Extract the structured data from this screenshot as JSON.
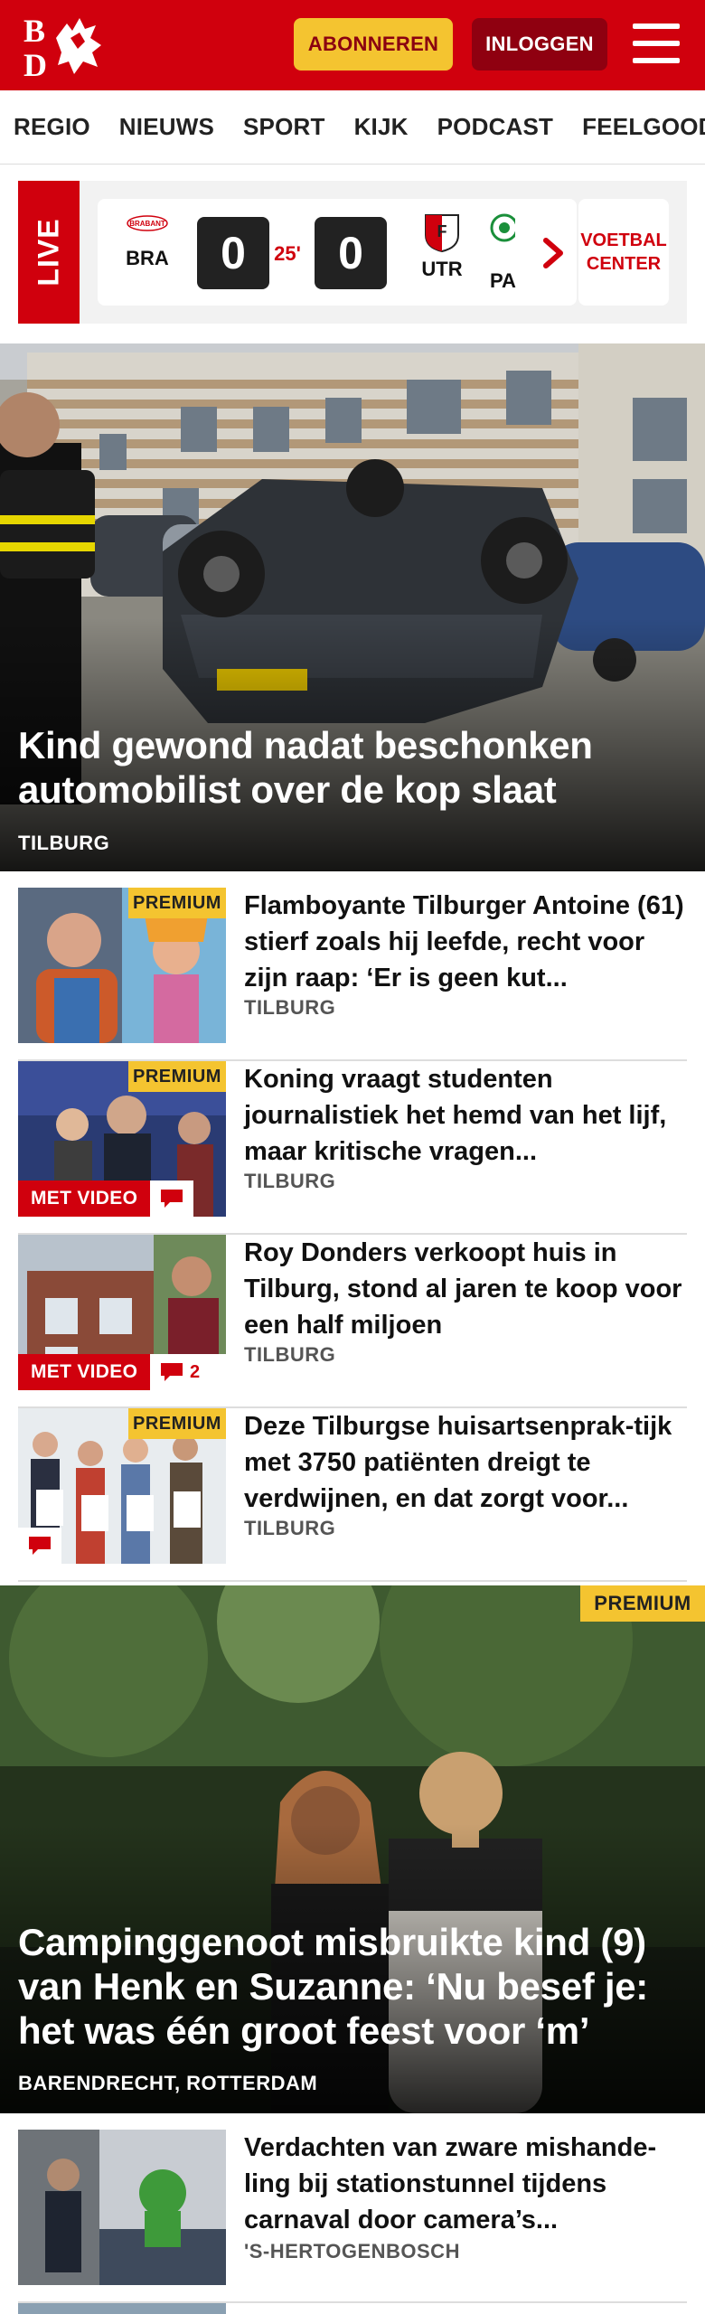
{
  "header": {
    "logo_icon": "bd-logo-icon",
    "subscribe_label": "ABONNEREN",
    "login_label": "INLOGGEN",
    "menu_icon": "hamburger-menu-icon",
    "brand_color": "#d0000d",
    "accent_color": "#f4c430"
  },
  "nav": {
    "items": [
      "REGIO",
      "NIEUWS",
      "SPORT",
      "KIJK",
      "PODCAST",
      "FEELGOOD"
    ]
  },
  "live": {
    "label": "LIVE",
    "match": {
      "home_code": "BRA",
      "home_logo_text": "BRABANT",
      "home_score": "0",
      "minute": "25'",
      "away_score": "0",
      "away_code": "UTR"
    },
    "next_match": {
      "home_code": "PA"
    },
    "center_label_line1": "VOETBAL",
    "center_label_line2": "CENTER"
  },
  "hero": {
    "title": "Kind gewond nadat beschonken automobilist over de kop slaat",
    "location": "TILBURG"
  },
  "articles": [
    {
      "title": "Flamboyante Tilburger Antoine (61) stierf zoals hij leefde, recht voor zijn raap: ‘Er is geen kut...",
      "location": "TILBURG",
      "premium": "PREMIUM"
    },
    {
      "title": "Koning vraagt studenten journalistiek het hemd van het lijf, maar kritische vragen...",
      "location": "TILBURG",
      "premium": "PREMIUM",
      "video": "MET VIDEO"
    },
    {
      "title": "Roy Donders verkoopt huis in Tilburg, stond al jaren te koop voor een half miljoen",
      "location": "TILBURG",
      "video": "MET VIDEO",
      "comments": "2"
    },
    {
      "title": "Deze Tilburgse huisartsenprak-tijk met 3750 patiënten dreigt te verdwijnen, en dat zorgt voor...",
      "location": "TILBURG",
      "premium": "PREMIUM"
    }
  ],
  "hero2": {
    "premium": "PREMIUM",
    "title": "Campinggenoot misbruikte kind (9) van Henk en Suzanne: ‘Nu besef je: het was één groot feest voor ‘m’",
    "location": "BARENDRECHT, ROTTERDAM"
  },
  "article_last": {
    "title": "Verdachten van zware mishande-ling bij stationstunnel tijdens carnaval door camera’s...",
    "location": "'S-HERTOGENBOSCH"
  }
}
